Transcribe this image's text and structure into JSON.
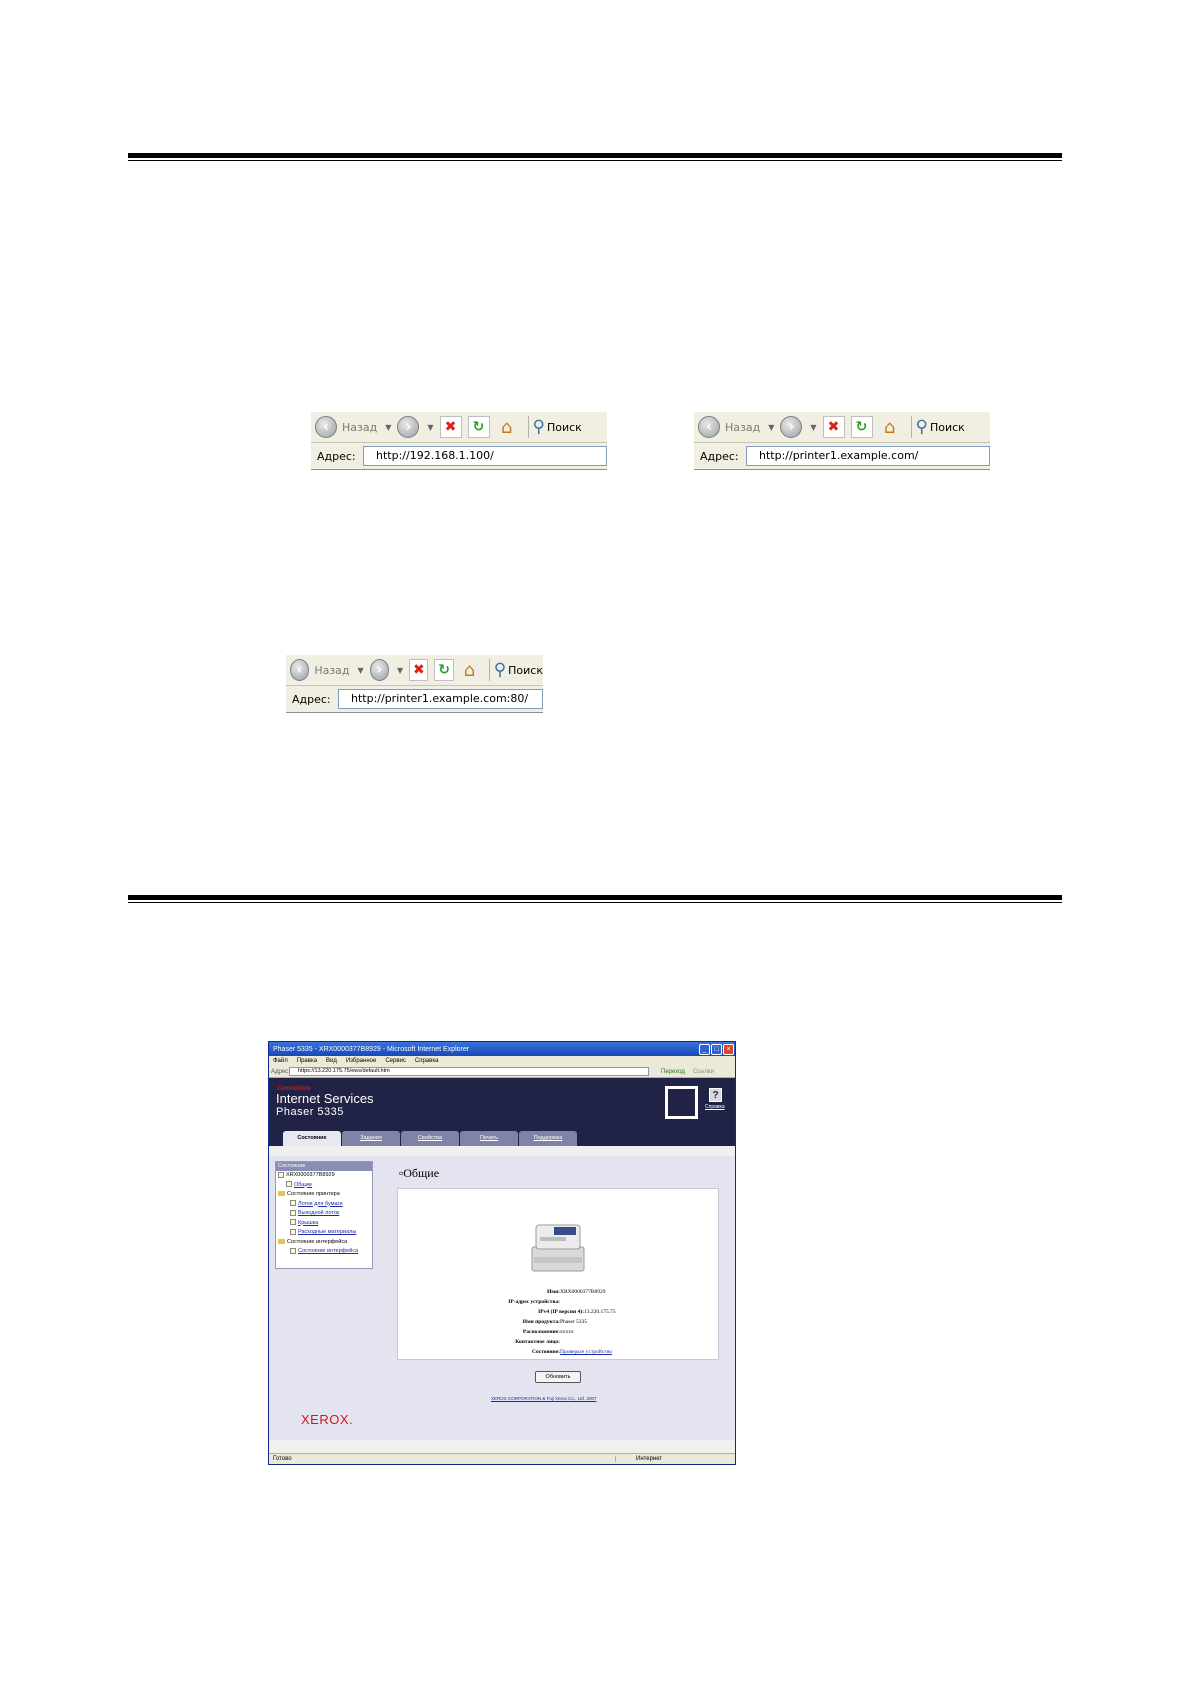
{
  "toolbar": {
    "back_label": "Назад",
    "search_label": "Поиск",
    "address_label": "Адрес:"
  },
  "address_examples": [
    {
      "url": "http://192.168.1.100/"
    },
    {
      "url": "http://printer1.example.com/"
    },
    {
      "url": "http://printer1.example.com:80/"
    }
  ],
  "browser": {
    "title": "Phaser 5335 - XRX0000377B8929 - Microsoft Internet Explorer",
    "menu": [
      "Файл",
      "Правка",
      "Вид",
      "Избранное",
      "Сервис",
      "Справка"
    ],
    "address_label": "Адрес:",
    "address_url": "https://13.220.175.75/ews/default.htm",
    "go_label": "Переход",
    "links_label": "Ссылки",
    "header": {
      "brand_small": "CentreWare",
      "brand": "Internet Services",
      "model": "Phaser 5335",
      "help_label": "Справка"
    },
    "tabs": [
      "Состояние",
      "Задания",
      "Свойства",
      "Печать",
      "Поддержка"
    ],
    "tree": {
      "header": "Состояние",
      "device": "XRX0000377B8929",
      "general": "Общие",
      "printer_status": "Состояние принтера",
      "trays": "Лотки для бумаги",
      "output": "Выходной лоток",
      "cabinet": "Крышка",
      "consumables": "Расходные материалы",
      "options_status": "Состояние интерфейса",
      "options_item": "Состояние интерфейса"
    },
    "page_title": "Общие",
    "props": {
      "name_key": "Имя:",
      "name_val": "XRX0000377B8929",
      "ip_key": "IP-адрес устройства:",
      "ipv4_key": "IPv4 (IP версии 4):",
      "ipv4_val": "13.220.175.75",
      "product_key": "Имя продукта:",
      "product_val": "Phaser 5335",
      "location_key": "Расположение:",
      "location_val": "ххххх",
      "contact_key": "Контактное лицо:",
      "status_key": "Состояние:",
      "status_val": "Проверьте устройство"
    },
    "refresh_button": "Обновить",
    "copyright": "XEROX CORPORATION & Fuji Xerox Co., Ltd. 2007",
    "logo": "XEROX.",
    "status_text": "Готово",
    "zone_text": "Интернет"
  }
}
